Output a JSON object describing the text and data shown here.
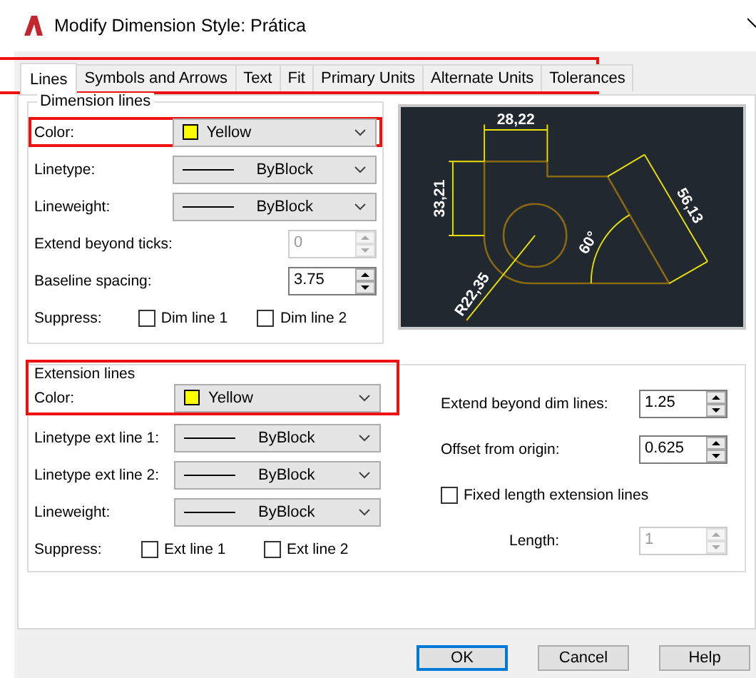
{
  "window": {
    "title": "Modify Dimension Style: Prática"
  },
  "tab_strip": {
    "highlighted": true,
    "tabs": [
      {
        "label": "Lines",
        "selected": true
      },
      {
        "label": "Symbols and Arrows",
        "selected": false
      },
      {
        "label": "Text",
        "selected": false
      },
      {
        "label": "Fit",
        "selected": false
      },
      {
        "label": "Primary Units",
        "selected": false
      },
      {
        "label": "Alternate Units",
        "selected": false
      },
      {
        "label": "Tolerances",
        "selected": false
      }
    ]
  },
  "dimension_lines": {
    "title": "Dimension lines",
    "rows": [
      {
        "kind": "color",
        "label": "Color:",
        "value": "Yellow",
        "color": "#ffff00",
        "highlighted": true
      },
      {
        "kind": "combo",
        "label": "Linetype:",
        "value": "ByBlock"
      },
      {
        "kind": "combo",
        "label": "Lineweight:",
        "value": "ByBlock"
      },
      {
        "kind": "spin",
        "label": "Extend beyond ticks:",
        "value": "0",
        "disabled": true
      },
      {
        "kind": "spin",
        "label": "Baseline spacing:",
        "value": "3.75",
        "disabled": false
      }
    ],
    "suppress": {
      "label": "Suppress:",
      "options": [
        {
          "label": "Dim line 1",
          "checked": false
        },
        {
          "label": "Dim line 2",
          "checked": false
        }
      ]
    }
  },
  "preview": {
    "labels": [
      "28,22",
      "33,21",
      "56,13",
      "60°",
      "R22,35"
    ]
  },
  "extension_lines": {
    "title": "Extension lines",
    "highlighted": true,
    "rows": [
      {
        "kind": "color",
        "label": "Color:",
        "value": "Yellow",
        "color": "#ffff00"
      },
      {
        "kind": "combo",
        "label": "Linetype ext line 1:",
        "value": "ByBlock"
      },
      {
        "kind": "combo",
        "label": "Linetype ext line 2:",
        "value": "ByBlock"
      },
      {
        "kind": "combo",
        "label": "Lineweight:",
        "value": "ByBlock"
      }
    ],
    "suppress": {
      "label": "Suppress:",
      "options": [
        {
          "label": "Ext line 1",
          "checked": false
        },
        {
          "label": "Ext line 2",
          "checked": false
        }
      ]
    },
    "right": [
      {
        "kind": "spin",
        "label": "Extend beyond dim lines:",
        "value": "1.25",
        "disabled": false
      },
      {
        "kind": "spin",
        "label": "Offset from origin:",
        "value": "0.625",
        "disabled": false
      },
      {
        "kind": "check",
        "label": "Fixed length extension lines",
        "checked": false
      },
      {
        "kind": "indented_spin",
        "label": "Length:",
        "value": "1",
        "disabled": true
      }
    ]
  },
  "buttons": [
    {
      "label": "OK",
      "default": true
    },
    {
      "label": "Cancel",
      "default": false
    },
    {
      "label": "Help",
      "default": false
    }
  ]
}
